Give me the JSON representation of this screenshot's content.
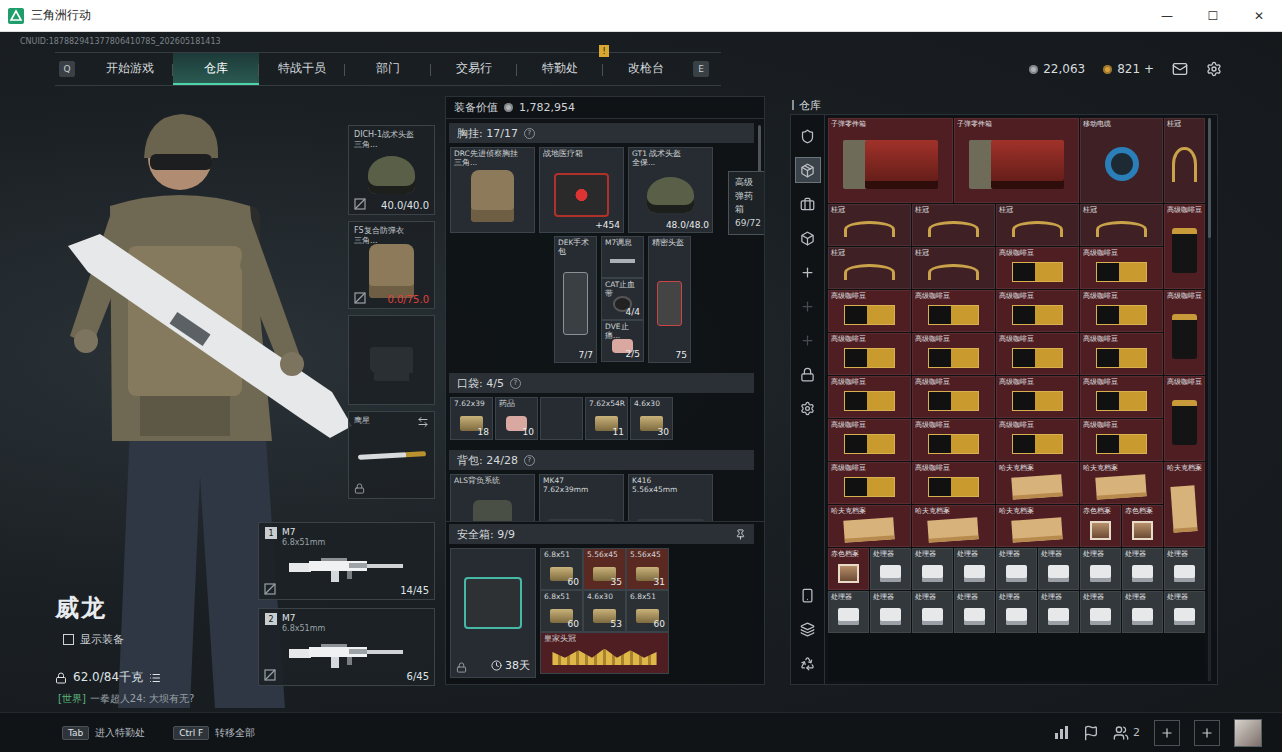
{
  "window": {
    "title": "三角洲行动",
    "controls": [
      "—",
      "☐",
      "✕"
    ]
  },
  "uid": "CNUID:18788294137780641078S_202605181413",
  "nav": {
    "left_key": "Q",
    "right_key": "E",
    "tabs": [
      {
        "label": "开始游戏",
        "selected": false,
        "badge": ""
      },
      {
        "label": "仓库",
        "selected": true,
        "badge": ""
      },
      {
        "label": "特战干员",
        "selected": false,
        "badge": ""
      },
      {
        "label": "部门",
        "selected": false,
        "badge": ""
      },
      {
        "label": "交易行",
        "selected": false,
        "badge": ""
      },
      {
        "label": "特勤处",
        "selected": false,
        "badge": "!"
      },
      {
        "label": "改枪台",
        "selected": false,
        "badge": ""
      }
    ]
  },
  "currency": [
    {
      "value": "22,063",
      "color": "#aeb4b9"
    },
    {
      "value": "821 +",
      "color": "#d6a13c"
    }
  ],
  "operator": {
    "name": "威龙",
    "show_gear": {
      "label": "显示装备",
      "checked": false
    },
    "weight": "62.0/84千克",
    "chat": {
      "channel": "[世界]",
      "text": "一拳超人24: 大坝有无?"
    }
  },
  "slots": [
    {
      "kind": "helmet",
      "name": "DICH-1战术头盔",
      "sub": "三角...",
      "reading": "40.0/40.0",
      "depleted": false,
      "broken_mark": true,
      "locked": false,
      "swap": false
    },
    {
      "kind": "armor",
      "name": "FS复合防弹衣",
      "sub": "三角...",
      "reading": "0.0/75.0",
      "depleted": true,
      "broken_mark": true,
      "locked": false,
      "swap": false
    },
    {
      "kind": "pistol",
      "name": "",
      "sub": "",
      "reading": "",
      "depleted": false,
      "broken_mark": false,
      "locked": false,
      "swap": false
    },
    {
      "kind": "melee",
      "name": "鹰星",
      "sub": "",
      "reading": "",
      "depleted": false,
      "broken_mark": false,
      "locked": true,
      "swap": true
    }
  ],
  "guns": [
    {
      "slot": "1",
      "name": "M7",
      "caliber": "6.8x51mm",
      "ammo": "14/45"
    },
    {
      "slot": "2",
      "name": "M7",
      "caliber": "6.8x51mm",
      "ammo": "6/45"
    }
  ],
  "equipment": {
    "value_label": "装备价值",
    "value": "1,782,954",
    "chest": {
      "title": "胸挂: 17/17",
      "help": "?",
      "main": [
        {
          "name": "DRC先进侦察胸挂",
          "sub": "三角...",
          "kind": "vest",
          "reading": ""
        },
        {
          "name": "战地医疗箱",
          "sub": "",
          "kind": "medkit",
          "reading": "+454"
        },
        {
          "name": "GT1 战术头盔",
          "sub": "全保...",
          "kind": "helmet",
          "reading": "48.0/48.0"
        }
      ],
      "side": {
        "left": {
          "name": "DEK手术包",
          "kind": "surgery",
          "reading": "7/7"
        },
        "stack": [
          {
            "name": "M7调息",
            "kind": "part",
            "reading": ""
          },
          {
            "name": "CAT止血带",
            "kind": "tourniquet",
            "reading": "4/4"
          },
          {
            "name": "DVE止痛...",
            "kind": "pills",
            "reading": "2/5"
          }
        ],
        "right": {
          "name": "精密头盔",
          "kind": "kit",
          "reading": "75"
        }
      },
      "tooltip": {
        "title": "高级弹药箱",
        "reading": "69/72"
      }
    },
    "pocket": {
      "title": "口袋: 4/5",
      "help": "?",
      "items": [
        {
          "name": "7.62x39",
          "count": "18",
          "kind": "ammo"
        },
        {
          "name": "药品",
          "count": "10",
          "kind": "pills"
        },
        {
          "name": "",
          "count": "",
          "kind": "empty"
        },
        {
          "name": "7.62x54R",
          "count": "11",
          "kind": "ammo"
        },
        {
          "name": "4.6x30",
          "count": "30",
          "kind": "ammo"
        }
      ]
    },
    "backpack": {
      "title": "背包: 24/28",
      "help": "?",
      "items": [
        {
          "name": "ALS背负系统",
          "sub": "",
          "kind": "backpack"
        },
        {
          "name": "MK47",
          "sub": "7.62x39mm",
          "kind": "rifle"
        },
        {
          "name": "K416",
          "sub": "5.56x45mm",
          "kind": "rifle"
        }
      ]
    },
    "safe": {
      "title": "安全箱: 9/9",
      "timer": "38天",
      "items": [
        {
          "name": "6.8x51",
          "count": "60",
          "kind": "ammo",
          "color": "#2b3035"
        },
        {
          "name": "5.56x45",
          "count": "35",
          "kind": "ammo",
          "color": "#5a2a22"
        },
        {
          "name": "5.56x45",
          "count": "31",
          "kind": "ammo",
          "color": "#5a2a22"
        },
        {
          "name": "6.8x51",
          "count": "60",
          "kind": "ammo",
          "color": "#2b3035"
        },
        {
          "name": "4.6x30",
          "count": "53",
          "kind": "ammo",
          "color": "#2b3035"
        },
        {
          "name": "6.8x51",
          "count": "60",
          "kind": "ammo",
          "color": "#2b3035"
        }
      ],
      "crown": {
        "name": "皇家头冠",
        "kind": "crown",
        "color": "#4f1e22"
      }
    }
  },
  "warehouse": {
    "title": "仓库",
    "sidebar": [
      {
        "kind": "shield",
        "selected": false,
        "disabled": false
      },
      {
        "kind": "package",
        "selected": true,
        "disabled": false
      },
      {
        "kind": "briefcase",
        "selected": false,
        "disabled": false
      },
      {
        "kind": "box",
        "selected": false,
        "disabled": false
      },
      {
        "kind": "plus",
        "selected": false,
        "disabled": false
      },
      {
        "kind": "plus",
        "selected": false,
        "disabled": true
      },
      {
        "kind": "plus",
        "selected": false,
        "disabled": true
      },
      {
        "kind": "lock",
        "selected": false,
        "disabled": false
      },
      {
        "kind": "settings",
        "selected": false,
        "disabled": false
      }
    ],
    "sidebar_bottom": [
      {
        "kind": "smartphone",
        "selected": false,
        "disabled": false
      },
      {
        "kind": "layers",
        "selected": false,
        "disabled": false
      },
      {
        "kind": "recycle",
        "selected": false,
        "disabled": false
      }
    ],
    "items": [
      {
        "name": "子弹零件箱",
        "kind": "crate",
        "slots": "3x2",
        "color": "#4f1e22"
      },
      {
        "name": "子弹零件箱",
        "kind": "crate",
        "slots": "3x2",
        "color": "#4f1e22"
      },
      {
        "name": "移动电缆",
        "kind": "cable",
        "slots": "2x2",
        "color": "#3f2125"
      },
      {
        "name": "桂冠",
        "kind": "laurel",
        "slots": "1x2",
        "color": "#3f2125"
      },
      {
        "name": "桂冠",
        "kind": "laurel",
        "slots": "2x1",
        "color": "#3f2125"
      },
      {
        "name": "桂冠",
        "kind": "laurel",
        "slots": "2x1",
        "color": "#3f2125"
      },
      {
        "name": "桂冠",
        "kind": "laurel",
        "slots": "2x1",
        "color": "#3f2125"
      },
      {
        "name": "桂冠",
        "kind": "laurel",
        "slots": "2x1",
        "color": "#3f2125"
      },
      {
        "name": "高级咖啡豆",
        "kind": "coffee-bag",
        "slots": "1x2",
        "color": "#4f1e22"
      },
      {
        "name": "桂冠",
        "kind": "laurel",
        "slots": "2x1",
        "color": "#3f2125"
      },
      {
        "name": "桂冠",
        "kind": "laurel",
        "slots": "2x1",
        "color": "#3f2125"
      },
      {
        "name": "高级咖啡豆",
        "kind": "coffee-box",
        "slots": "2x1",
        "color": "#4f1e22"
      },
      {
        "name": "高级咖啡豆",
        "kind": "coffee-box",
        "slots": "2x1",
        "color": "#4f1e22"
      },
      {
        "name": "高级咖啡豆",
        "kind": "coffee-box",
        "slots": "2x1",
        "color": "#4f1e22"
      },
      {
        "name": "高级咖啡豆",
        "kind": "coffee-box",
        "slots": "2x1",
        "color": "#4f1e22"
      },
      {
        "name": "高级咖啡豆",
        "kind": "coffee-box",
        "slots": "2x1",
        "color": "#4f1e22"
      },
      {
        "name": "高级咖啡豆",
        "kind": "coffee-box",
        "slots": "2x1",
        "color": "#4f1e22"
      },
      {
        "name": "高级咖啡豆",
        "kind": "coffee-bag",
        "slots": "1x2",
        "color": "#4f1e22"
      },
      {
        "name": "高级咖啡豆",
        "kind": "coffee-box",
        "slots": "2x1",
        "color": "#4f1e22"
      },
      {
        "name": "高级咖啡豆",
        "kind": "coffee-box",
        "slots": "2x1",
        "color": "#4f1e22"
      },
      {
        "name": "高级咖啡豆",
        "kind": "coffee-box",
        "slots": "2x1",
        "color": "#4f1e22"
      },
      {
        "name": "高级咖啡豆",
        "kind": "coffee-box",
        "slots": "2x1",
        "color": "#4f1e22"
      },
      {
        "name": "高级咖啡豆",
        "kind": "coffee-box",
        "slots": "2x1",
        "color": "#4f1e22"
      },
      {
        "name": "高级咖啡豆",
        "kind": "coffee-box",
        "slots": "2x1",
        "color": "#4f1e22"
      },
      {
        "name": "高级咖啡豆",
        "kind": "coffee-box",
        "slots": "2x1",
        "color": "#4f1e22"
      },
      {
        "name": "高级咖啡豆",
        "kind": "coffee-box",
        "slots": "2x1",
        "color": "#4f1e22"
      },
      {
        "name": "高级咖啡豆",
        "kind": "coffee-bag",
        "slots": "1x2",
        "color": "#4f1e22"
      },
      {
        "name": "高级咖啡豆",
        "kind": "coffee-box",
        "slots": "2x1",
        "color": "#4f1e22"
      },
      {
        "name": "高级咖啡豆",
        "kind": "coffee-box",
        "slots": "2x1",
        "color": "#4f1e22"
      },
      {
        "name": "高级咖啡豆",
        "kind": "coffee-box",
        "slots": "2x1",
        "color": "#4f1e22"
      },
      {
        "name": "高级咖啡豆",
        "kind": "coffee-box",
        "slots": "2x1",
        "color": "#4f1e22"
      },
      {
        "name": "高级咖啡豆",
        "kind": "coffee-box",
        "slots": "2x1",
        "color": "#4f1e22"
      },
      {
        "name": "高级咖啡豆",
        "kind": "coffee-box",
        "slots": "2x1",
        "color": "#4f1e22"
      },
      {
        "name": "哈夫克档案",
        "kind": "file",
        "slots": "2x1",
        "color": "#4f1e22"
      },
      {
        "name": "哈夫克档案",
        "kind": "file",
        "slots": "2x1",
        "color": "#4f1e22"
      },
      {
        "name": "哈夫克档案",
        "kind": "file",
        "slots": "1x2",
        "color": "#4f1e22"
      },
      {
        "name": "哈夫克档案",
        "kind": "file",
        "slots": "2x1",
        "color": "#4f1e22"
      },
      {
        "name": "哈夫克档案",
        "kind": "file",
        "slots": "2x1",
        "color": "#4f1e22"
      },
      {
        "name": "哈夫克档案",
        "kind": "file",
        "slots": "2x1",
        "color": "#4f1e22"
      },
      {
        "name": "赤色档案",
        "kind": "photo",
        "slots": "1x1",
        "color": "#4f1e22"
      },
      {
        "name": "赤色档案",
        "kind": "photo",
        "slots": "1x1",
        "color": "#4f1e22"
      },
      {
        "name": "赤色档案",
        "kind": "photo",
        "slots": "1x1",
        "color": "#4f1e22"
      },
      {
        "name": "处理器",
        "kind": "chip",
        "slots": "1x1",
        "color": "#33383c"
      },
      {
        "name": "处理器",
        "kind": "chip",
        "slots": "1x1",
        "color": "#33383c"
      },
      {
        "name": "处理器",
        "kind": "chip",
        "slots": "1x1",
        "color": "#33383c"
      },
      {
        "name": "处理器",
        "kind": "chip",
        "slots": "1x1",
        "color": "#33383c"
      },
      {
        "name": "处理器",
        "kind": "chip",
        "slots": "1x1",
        "color": "#33383c"
      },
      {
        "name": "处理器",
        "kind": "chip",
        "slots": "1x1",
        "color": "#33383c"
      },
      {
        "name": "处理器",
        "kind": "chip",
        "slots": "1x1",
        "color": "#33383c"
      },
      {
        "name": "处理器",
        "kind": "chip",
        "slots": "1x1",
        "color": "#33383c"
      },
      {
        "name": "处理器",
        "kind": "chip",
        "slots": "1x1",
        "color": "#33383c"
      },
      {
        "name": "处理器",
        "kind": "chip",
        "slots": "1x1",
        "color": "#33383c"
      },
      {
        "name": "处理器",
        "kind": "chip",
        "slots": "1x1",
        "color": "#33383c"
      },
      {
        "name": "处理器",
        "kind": "chip",
        "slots": "1x1",
        "color": "#33383c"
      },
      {
        "name": "处理器",
        "kind": "chip",
        "slots": "1x1",
        "color": "#33383c"
      },
      {
        "name": "处理器",
        "kind": "chip",
        "slots": "1x1",
        "color": "#33383c"
      },
      {
        "name": "处理器",
        "kind": "chip",
        "slots": "1x1",
        "color": "#33383c"
      },
      {
        "name": "处理器",
        "kind": "chip",
        "slots": "1x1",
        "color": "#33383c"
      },
      {
        "name": "处理器",
        "kind": "chip",
        "slots": "1x1",
        "color": "#33383c"
      }
    ]
  },
  "bottom": {
    "hints": [
      {
        "key": "Tab",
        "label": "进入特勤处"
      },
      {
        "key": "Ctrl F",
        "label": "转移全部"
      }
    ],
    "friends": "2"
  }
}
